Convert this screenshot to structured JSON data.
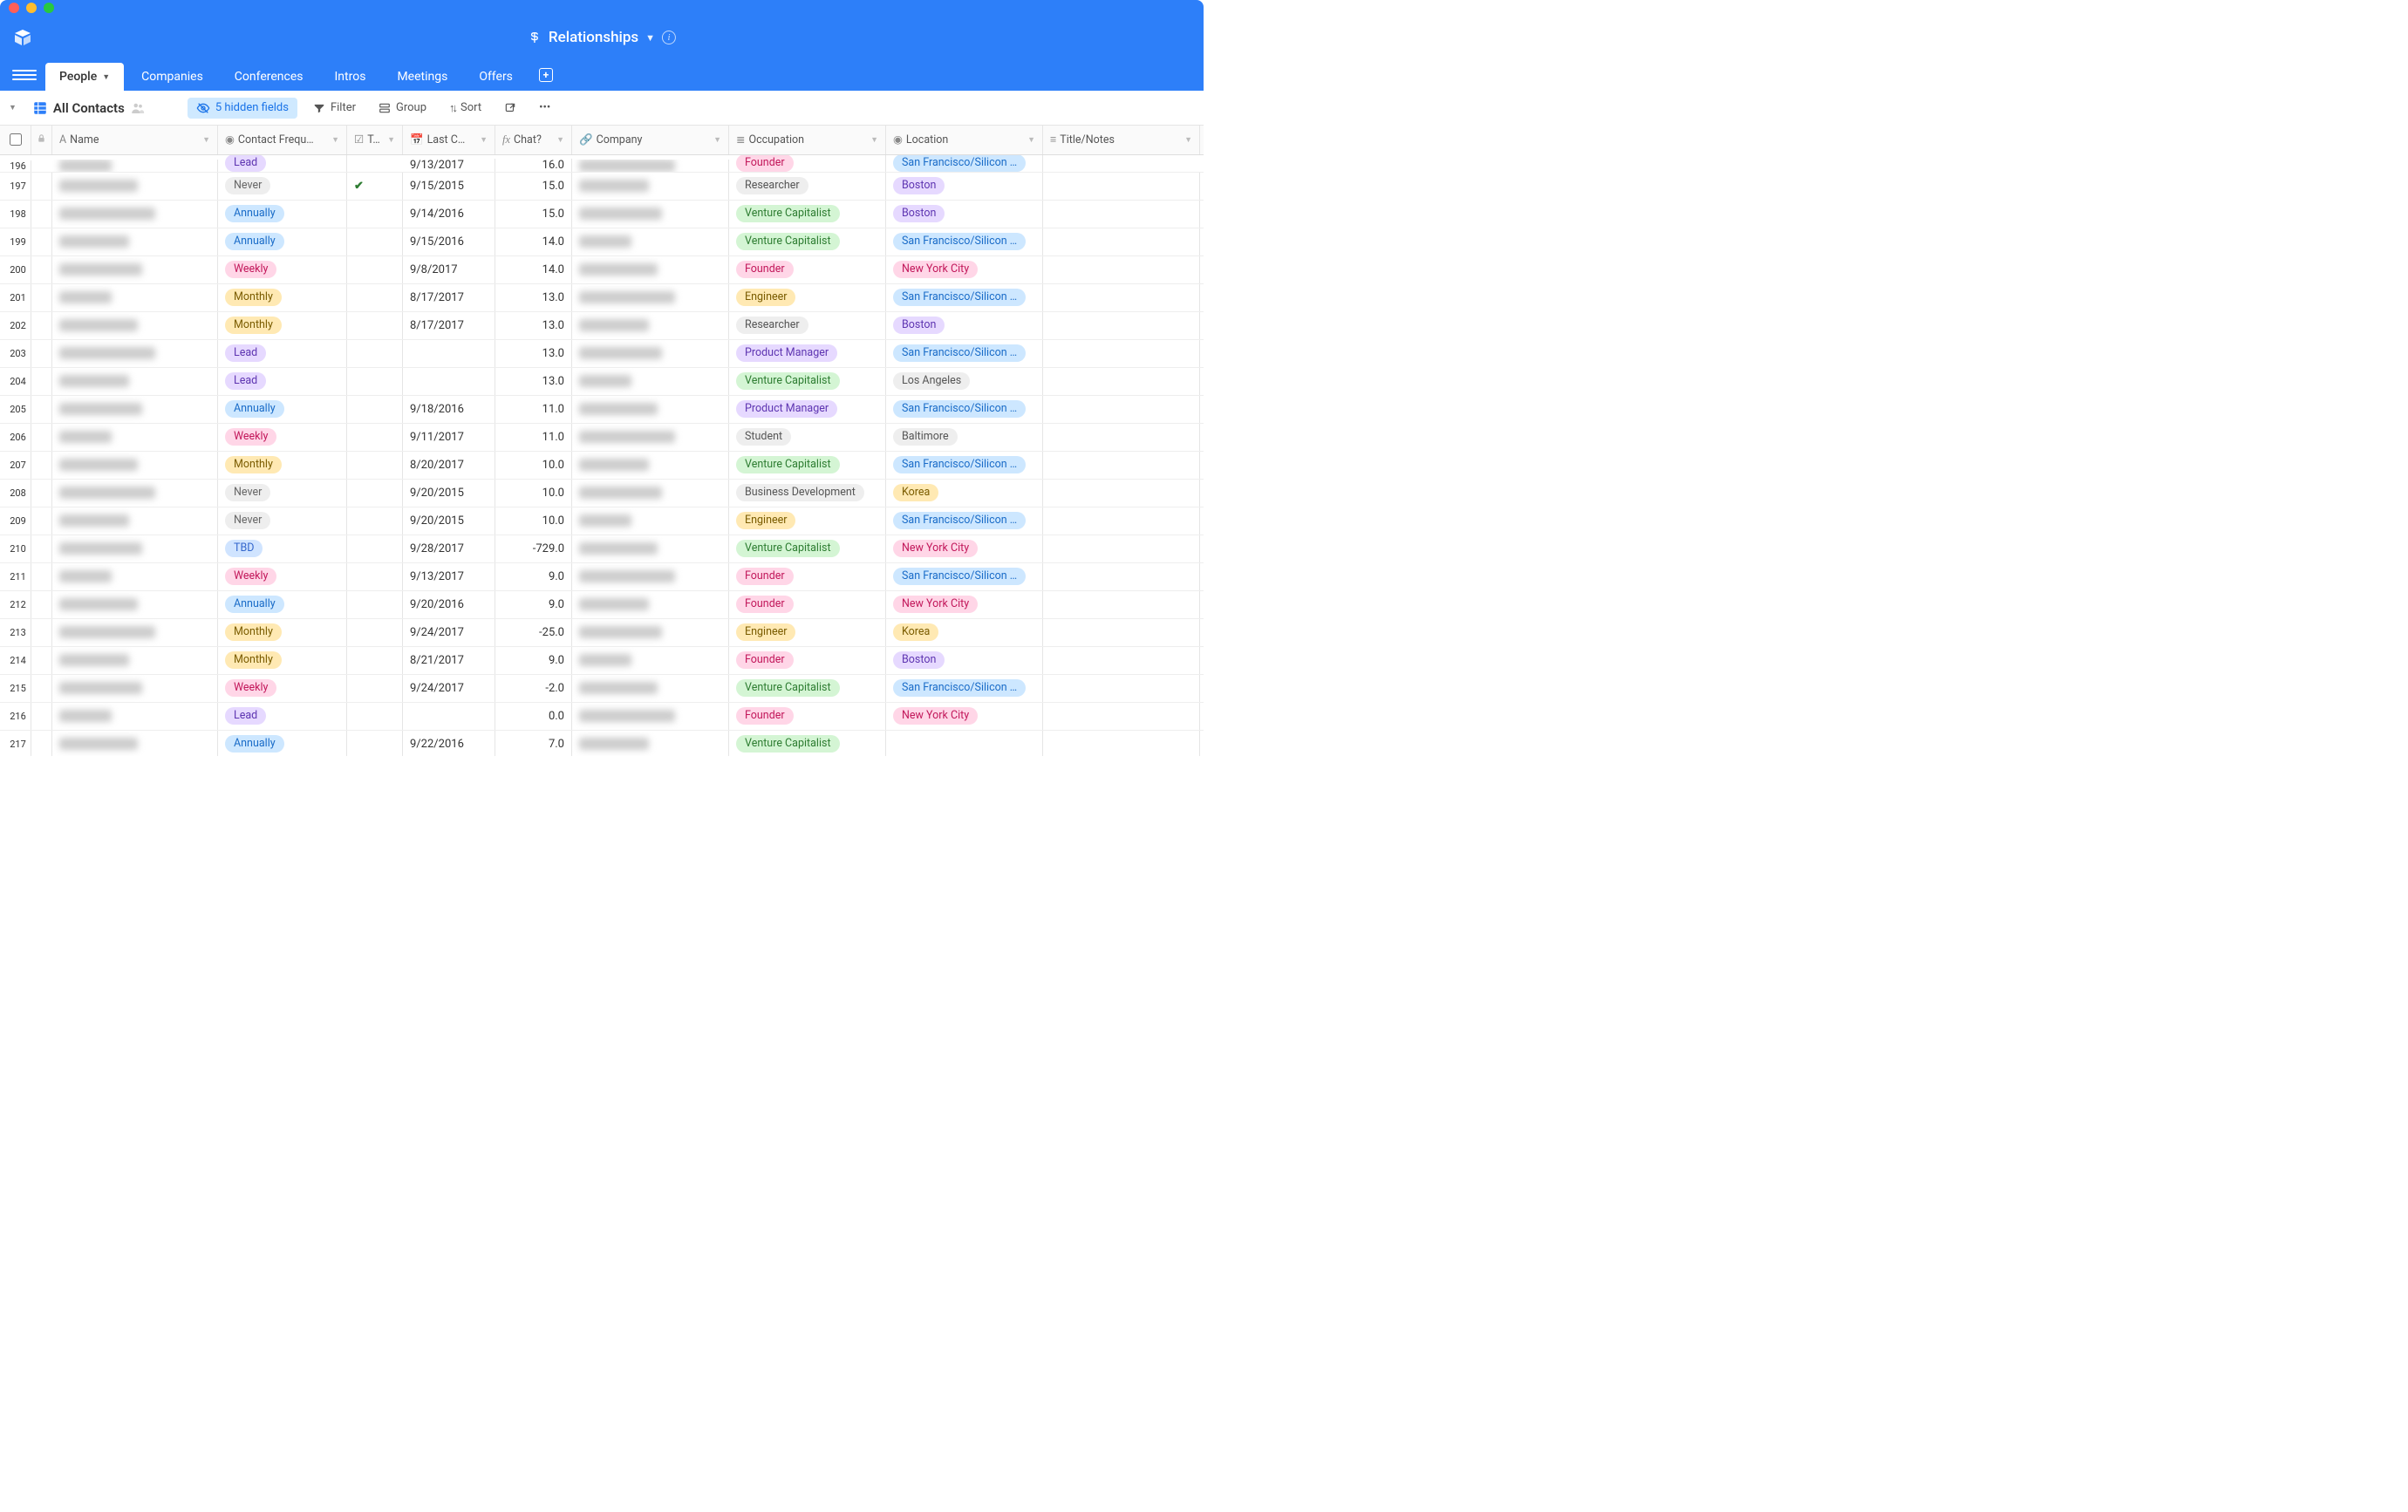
{
  "base": {
    "name": "Relationships"
  },
  "tabs": [
    {
      "label": "People",
      "active": true
    },
    {
      "label": "Companies"
    },
    {
      "label": "Conferences"
    },
    {
      "label": "Intros"
    },
    {
      "label": "Meetings"
    },
    {
      "label": "Offers"
    }
  ],
  "toolbar": {
    "viewName": "All Contacts",
    "hiddenFields": "5 hidden fields",
    "filter": "Filter",
    "group": "Group",
    "sort": "Sort"
  },
  "columns": {
    "name": "Name",
    "freq": "Contact Frequ…",
    "t": "T…",
    "last": "Last C…",
    "chat": "Chat?",
    "company": "Company",
    "occupation": "Occupation",
    "location": "Location",
    "title": "Title/Notes"
  },
  "freqClass": {
    "Lead": "p-lead",
    "Never": "p-never",
    "Annually": "p-annually",
    "Weekly": "p-weekly",
    "Monthly": "p-monthly",
    "TBD": "p-tbd"
  },
  "occClass": {
    "Founder": "p-founder",
    "Researcher": "p-researcher",
    "Venture Capitalist": "p-vc",
    "Engineer": "p-engineer",
    "Product Manager": "p-pm",
    "Student": "p-student",
    "Business Development": "p-bizdev"
  },
  "locClass": {
    "San Francisco/Silicon …": "p-sf",
    "Boston": "p-boston",
    "New York City": "p-nyc",
    "Los Angeles": "p-la",
    "Baltimore": "p-balt",
    "Korea": "p-korea"
  },
  "rows": [
    {
      "num": 196,
      "freq": "Lead",
      "t": false,
      "last": "9/13/2017",
      "chat": "16.0",
      "occ": "Founder",
      "loc": "San Francisco/Silicon …"
    },
    {
      "num": 197,
      "freq": "Never",
      "t": true,
      "last": "9/15/2015",
      "chat": "15.0",
      "occ": "Researcher",
      "loc": "Boston"
    },
    {
      "num": 198,
      "freq": "Annually",
      "t": false,
      "last": "9/14/2016",
      "chat": "15.0",
      "occ": "Venture Capitalist",
      "loc": "Boston"
    },
    {
      "num": 199,
      "freq": "Annually",
      "t": false,
      "last": "9/15/2016",
      "chat": "14.0",
      "occ": "Venture Capitalist",
      "loc": "San Francisco/Silicon …"
    },
    {
      "num": 200,
      "freq": "Weekly",
      "t": false,
      "last": "9/8/2017",
      "chat": "14.0",
      "occ": "Founder",
      "loc": "New York City"
    },
    {
      "num": 201,
      "freq": "Monthly",
      "t": false,
      "last": "8/17/2017",
      "chat": "13.0",
      "occ": "Engineer",
      "loc": "San Francisco/Silicon …"
    },
    {
      "num": 202,
      "freq": "Monthly",
      "t": false,
      "last": "8/17/2017",
      "chat": "13.0",
      "occ": "Researcher",
      "loc": "Boston"
    },
    {
      "num": 203,
      "freq": "Lead",
      "t": false,
      "last": "",
      "chat": "13.0",
      "occ": "Product Manager",
      "loc": "San Francisco/Silicon …"
    },
    {
      "num": 204,
      "freq": "Lead",
      "t": false,
      "last": "",
      "chat": "13.0",
      "occ": "Venture Capitalist",
      "loc": "Los Angeles"
    },
    {
      "num": 205,
      "freq": "Annually",
      "t": false,
      "last": "9/18/2016",
      "chat": "11.0",
      "occ": "Product Manager",
      "loc": "San Francisco/Silicon …"
    },
    {
      "num": 206,
      "freq": "Weekly",
      "t": false,
      "last": "9/11/2017",
      "chat": "11.0",
      "occ": "Student",
      "loc": "Baltimore"
    },
    {
      "num": 207,
      "freq": "Monthly",
      "t": false,
      "last": "8/20/2017",
      "chat": "10.0",
      "occ": "Venture Capitalist",
      "loc": "San Francisco/Silicon …"
    },
    {
      "num": 208,
      "freq": "Never",
      "t": false,
      "last": "9/20/2015",
      "chat": "10.0",
      "occ": "Business Development",
      "loc": "Korea"
    },
    {
      "num": 209,
      "freq": "Never",
      "t": false,
      "last": "9/20/2015",
      "chat": "10.0",
      "occ": "Engineer",
      "loc": "San Francisco/Silicon …"
    },
    {
      "num": 210,
      "freq": "TBD",
      "t": false,
      "last": "9/28/2017",
      "chat": "-729.0",
      "occ": "Venture Capitalist",
      "loc": "New York City"
    },
    {
      "num": 211,
      "freq": "Weekly",
      "t": false,
      "last": "9/13/2017",
      "chat": "9.0",
      "occ": "Founder",
      "loc": "San Francisco/Silicon …"
    },
    {
      "num": 212,
      "freq": "Annually",
      "t": false,
      "last": "9/20/2016",
      "chat": "9.0",
      "occ": "Founder",
      "loc": "New York City"
    },
    {
      "num": 213,
      "freq": "Monthly",
      "t": false,
      "last": "9/24/2017",
      "chat": "-25.0",
      "occ": "Engineer",
      "loc": "Korea"
    },
    {
      "num": 214,
      "freq": "Monthly",
      "t": false,
      "last": "8/21/2017",
      "chat": "9.0",
      "occ": "Founder",
      "loc": "Boston"
    },
    {
      "num": 215,
      "freq": "Weekly",
      "t": false,
      "last": "9/24/2017",
      "chat": "-2.0",
      "occ": "Venture Capitalist",
      "loc": "San Francisco/Silicon …"
    },
    {
      "num": 216,
      "freq": "Lead",
      "t": false,
      "last": "",
      "chat": "0.0",
      "occ": "Founder",
      "loc": "New York City"
    },
    {
      "num": 217,
      "freq": "Annually",
      "t": false,
      "last": "9/22/2016",
      "chat": "7.0",
      "occ": "Venture Capitalist",
      "loc": ""
    }
  ]
}
